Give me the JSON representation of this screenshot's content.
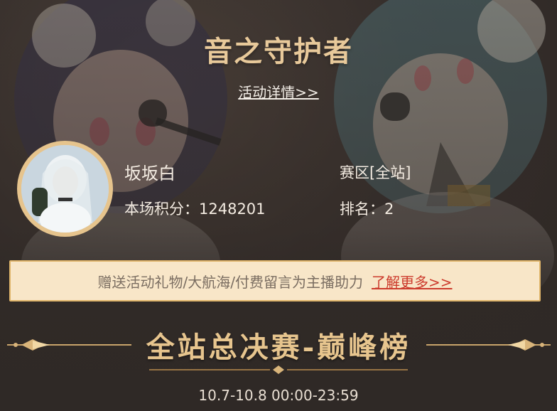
{
  "header": {
    "title": "音之守护者",
    "detail_link": "活动详情>>"
  },
  "user": {
    "name": "坂坂白",
    "score_label": "本场积分：",
    "score": "1248201",
    "zone": "赛区[全站]",
    "rank_label": "排名：",
    "rank": "2"
  },
  "banner": {
    "text": "赠送活动礼物/大航海/付费留言为主播助力",
    "more_link": "了解更多>>"
  },
  "final": {
    "title": "全站总决赛-巅峰榜",
    "date": "10.7-10.8 00:00-23:59"
  },
  "colors": {
    "gold": "#e7c58e",
    "banner_bg": "#f8e6c8",
    "link_red": "#cc3b2d"
  }
}
